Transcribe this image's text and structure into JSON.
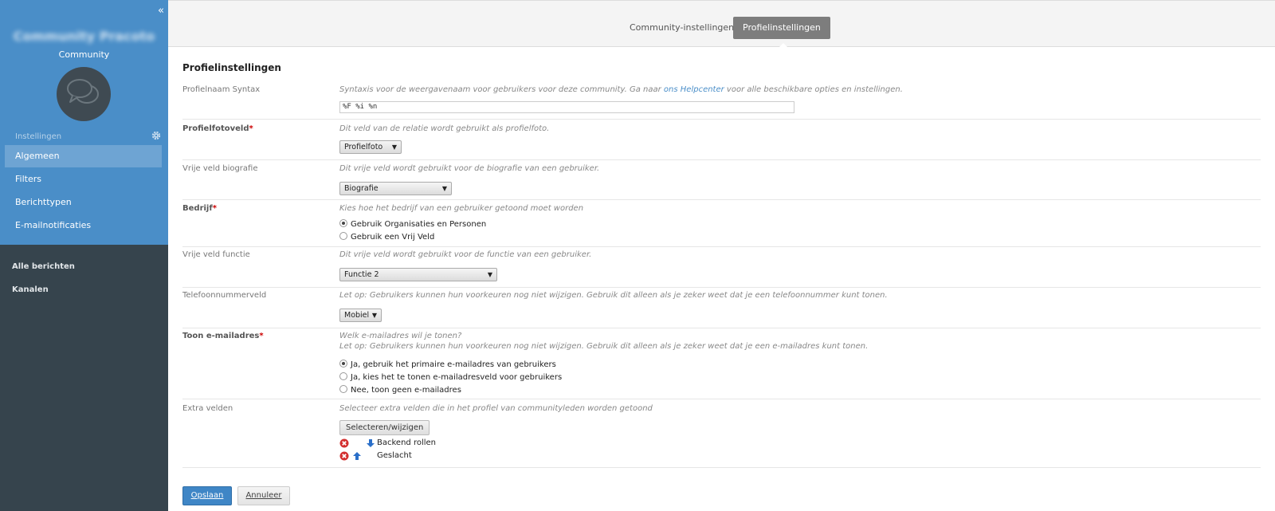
{
  "sidebar": {
    "community_name": "Community Pracoto",
    "community_label": "Community",
    "section_label": "Instellingen",
    "nav": [
      {
        "label": "Algemeen",
        "active": true
      },
      {
        "label": "Filters",
        "active": false
      },
      {
        "label": "Berichttypen",
        "active": false
      },
      {
        "label": "E-mailnotificaties",
        "active": false
      }
    ],
    "bottom_links": [
      "Alle berichten",
      "Kanalen"
    ],
    "collapse_glyph": "«"
  },
  "tabs": [
    {
      "label": "Community-instellingen",
      "active": false
    },
    {
      "label": "Profielinstellingen",
      "active": true
    }
  ],
  "page_heading": "Profielinstellingen",
  "fields": {
    "syntax": {
      "label": "Profielnaam Syntax",
      "hint_before": "Syntaxis voor de weergavenaam voor gebruikers voor deze community. Ga naar ",
      "hint_link": "ons Helpcenter",
      "hint_after": " voor alle beschikbare opties en instellingen.",
      "value": "%F %i %n"
    },
    "photo": {
      "label": "Profielfotoveld",
      "required": "*",
      "hint": "Dit veld van de relatie wordt gebruikt als profielfoto.",
      "selected": "Profielfoto"
    },
    "bio": {
      "label": "Vrije veld biografie",
      "hint": "Dit vrije veld wordt gebruikt voor de biografie van een gebruiker.",
      "selected": "Biografie"
    },
    "company": {
      "label": "Bedrijf",
      "required": "*",
      "hint": "Kies hoe het bedrijf van een gebruiker getoond moet worden",
      "options": [
        {
          "label": "Gebruik Organisaties en Personen",
          "checked": true
        },
        {
          "label": "Gebruik een Vrij Veld",
          "checked": false
        }
      ]
    },
    "function": {
      "label": "Vrije veld functie",
      "hint": "Dit vrije veld wordt gebruikt voor de functie van een gebruiker.",
      "selected": "Functie 2"
    },
    "phone": {
      "label": "Telefoonnummerveld",
      "hint": "Let op: Gebruikers kunnen hun voorkeuren nog niet wijzigen. Gebruik dit alleen als je zeker weet dat je een telefoonnummer kunt tonen.",
      "selected": "Mobiel"
    },
    "email": {
      "label": "Toon e-mailadres",
      "required": "*",
      "hint1": "Welk e-mailadres wil je tonen?",
      "hint2": "Let op: Gebruikers kunnen hun voorkeuren nog niet wijzigen. Gebruik dit alleen als je zeker weet dat je een e-mailadres kunt tonen.",
      "options": [
        {
          "label": "Ja, gebruik het primaire e-mailadres van gebruikers",
          "checked": true
        },
        {
          "label": "Ja, kies het te tonen e-mailadresveld voor gebruikers",
          "checked": false
        },
        {
          "label": "Nee, toon geen e-mailadres",
          "checked": false
        }
      ]
    },
    "extra": {
      "label": "Extra velden",
      "hint": "Selecteer extra velden die in het profiel van communityleden worden getoond",
      "button": "Selecteren/wijzigen",
      "items": [
        {
          "label": "Backend rollen",
          "arrow": "down"
        },
        {
          "label": "Geslacht",
          "arrow": "up"
        }
      ]
    }
  },
  "actions": {
    "save": "Opslaan",
    "cancel": "Annuleer"
  },
  "colors": {
    "sidebar_top": "#4a8ec8",
    "sidebar_bottom": "#36444d",
    "accent": "#3f86c6",
    "required": "#cc0000"
  },
  "icons": [
    "collapse-icon",
    "chat-bubbles-icon",
    "gear-icon",
    "remove-icon",
    "arrow-down-icon",
    "arrow-up-icon"
  ]
}
